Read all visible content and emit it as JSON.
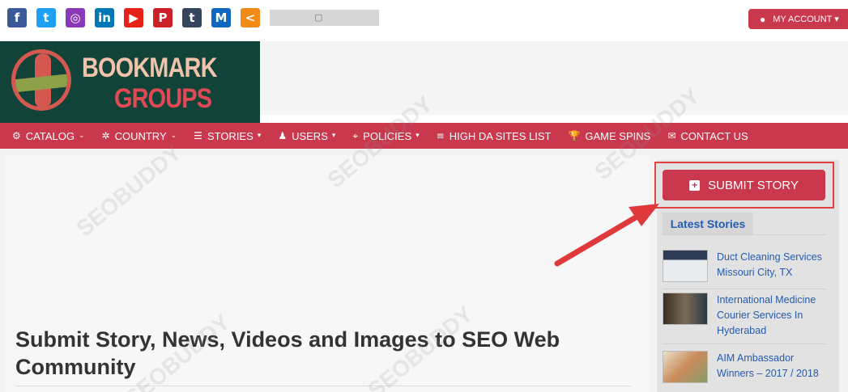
{
  "topbar": {
    "social_icons": [
      {
        "name": "facebook-icon",
        "glyph": "f",
        "color": "#3b5998"
      },
      {
        "name": "twitter-icon",
        "glyph": "t",
        "color": "#1da1f2"
      },
      {
        "name": "instagram-icon",
        "glyph": "◎",
        "color": "#8a3ab9"
      },
      {
        "name": "linkedin-icon",
        "glyph": "in",
        "color": "#0077b5"
      },
      {
        "name": "youtube-icon",
        "glyph": "▶",
        "color": "#e62117"
      },
      {
        "name": "pinterest-icon",
        "glyph": "P",
        "color": "#cb2027"
      },
      {
        "name": "tumblr-icon",
        "glyph": "t",
        "color": "#35465c"
      },
      {
        "name": "medium-icon",
        "glyph": "M",
        "color": "#0f67c0"
      },
      {
        "name": "share-icon",
        "glyph": "<",
        "color": "#f28a16"
      }
    ],
    "account_label": "MY ACCOUNT ▾"
  },
  "logo": {
    "line1": "BOOKMARK",
    "line2": "GROUPS"
  },
  "nav": [
    {
      "icon": "⚙",
      "label": "CATALOG",
      "caret": "⌄"
    },
    {
      "icon": "✲",
      "label": "COUNTRY",
      "caret": "⌄"
    },
    {
      "icon": "☰",
      "label": "STORIES",
      "caret": "▾"
    },
    {
      "icon": "♟",
      "label": "USERS",
      "caret": "▾"
    },
    {
      "icon": "⌖",
      "label": "POLICIES",
      "caret": "▾"
    },
    {
      "icon": "≡",
      "label": "HIGH DA SITES LIST",
      "caret": ""
    },
    {
      "icon": "🏆",
      "label": "GAME SPINS",
      "caret": ""
    },
    {
      "icon": "✉",
      "label": "CONTACT US",
      "caret": ""
    }
  ],
  "main": {
    "title": "Submit Story, News, Videos and Images to SEO Web Community"
  },
  "sidebar": {
    "submit_label": "SUBMIT STORY",
    "latest_label": "Latest Stories",
    "stories": [
      {
        "title": "Duct Cleaning Services Missouri City, TX"
      },
      {
        "title": "International Medicine Courier Services In Hyderabad"
      },
      {
        "title": "AIM Ambassador Winners – 2017 / 2018"
      }
    ]
  },
  "colors": {
    "brand_red": "#c9384d",
    "dark_green": "#124338",
    "link_blue": "#245bb0"
  }
}
